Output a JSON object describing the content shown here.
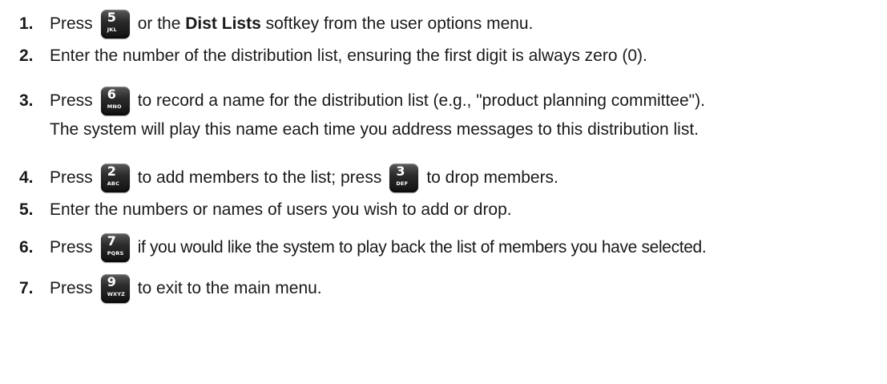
{
  "steps": [
    {
      "number": "1.",
      "press": "Press",
      "key": {
        "digit": "5",
        "letters": "JKL"
      },
      "text_before_bold": "or the",
      "bold": "Dist Lists",
      "text_after_bold": "softkey from the user options menu."
    },
    {
      "number": "2.",
      "text": "Enter the number of the distribution list, ensuring the first digit is always zero (0)."
    },
    {
      "number": "3.",
      "press": "Press",
      "key": {
        "digit": "6",
        "letters": "MNO"
      },
      "text": "to record a name for the distribution list (e.g., \"product planning committee\").",
      "continuation": "The system will play this name each time you address messages to this distribution list."
    },
    {
      "number": "4.",
      "press": "Press",
      "key": {
        "digit": "2",
        "letters": "ABC"
      },
      "text": "to add members to the list; press",
      "key2": {
        "digit": "3",
        "letters": "DEF"
      },
      "text2": "to drop members."
    },
    {
      "number": "5.",
      "text": "Enter the numbers or names of users you wish to add or drop."
    },
    {
      "number": "6.",
      "press": "Press",
      "key": {
        "digit": "7",
        "letters": "PQRS"
      },
      "text": "if you would like the system to play back the list of members you have selected."
    },
    {
      "number": "7.",
      "press": "Press",
      "key": {
        "digit": "9",
        "letters": "WXYZ"
      },
      "text": "to exit to the main menu."
    }
  ]
}
